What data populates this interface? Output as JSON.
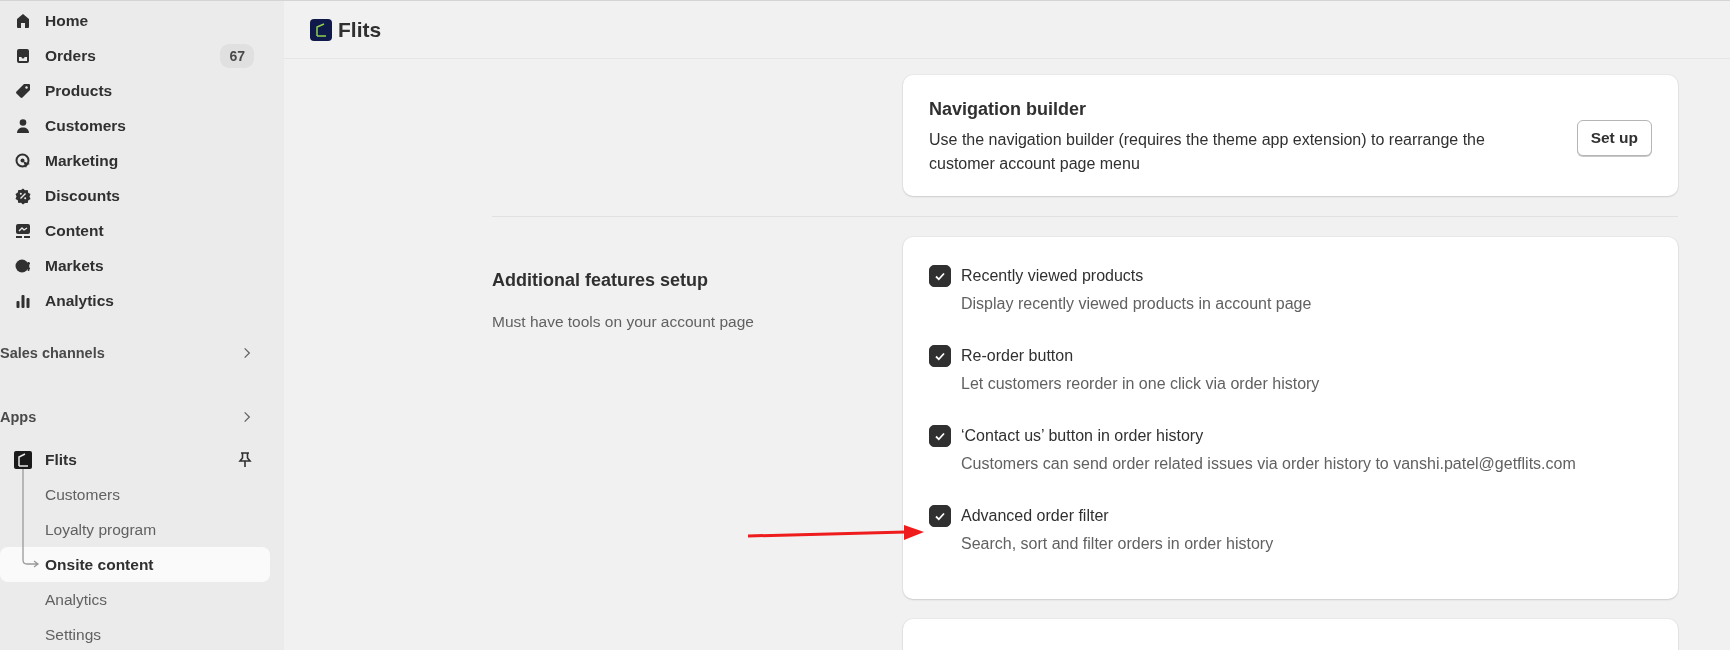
{
  "sidebar": {
    "items": [
      {
        "label": "Home"
      },
      {
        "label": "Orders",
        "badge": "67"
      },
      {
        "label": "Products"
      },
      {
        "label": "Customers"
      },
      {
        "label": "Marketing"
      },
      {
        "label": "Discounts"
      },
      {
        "label": "Content"
      },
      {
        "label": "Markets"
      },
      {
        "label": "Analytics"
      }
    ],
    "sections": [
      {
        "label": "Sales channels"
      },
      {
        "label": "Apps"
      }
    ],
    "app": {
      "name": "Flits",
      "pinned": true,
      "children": [
        {
          "label": "Customers",
          "selected": false
        },
        {
          "label": "Loyalty program",
          "selected": false
        },
        {
          "label": "Onsite content",
          "selected": true
        },
        {
          "label": "Analytics",
          "selected": false
        },
        {
          "label": "Settings",
          "selected": false
        }
      ]
    }
  },
  "header": {
    "title": "Flits"
  },
  "navigation_card": {
    "title": "Navigation builder",
    "description": "Use the navigation builder (requires the theme app extension) to rearrange the customer account page menu",
    "button": "Set up"
  },
  "features": {
    "title": "Additional features setup",
    "description": "Must have tools on your account page",
    "items": [
      {
        "title": "Recently viewed products",
        "description": "Display recently viewed products in account page",
        "checked": true
      },
      {
        "title": "Re-order button",
        "description": "Let customers reorder in one click via order history",
        "checked": true
      },
      {
        "title": "‘Contact us’ button in order history",
        "description": "Customers can send order related issues via order history to vanshi.patel@getflits.com",
        "checked": true
      },
      {
        "title": "Advanced order filter",
        "description": "Search, sort and filter orders in order history",
        "checked": true
      }
    ]
  }
}
